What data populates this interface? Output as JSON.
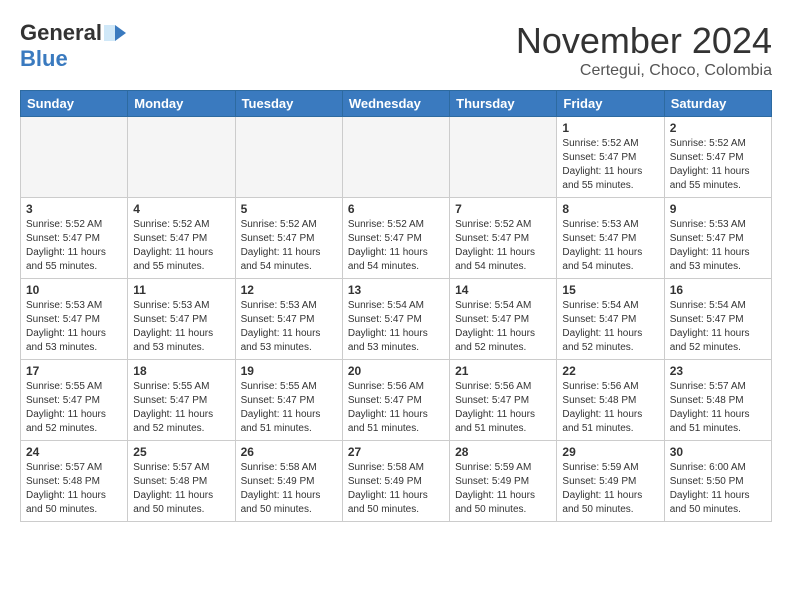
{
  "logo": {
    "general": "General",
    "blue": "Blue"
  },
  "title": "November 2024",
  "location": "Certegui, Choco, Colombia",
  "headers": [
    "Sunday",
    "Monday",
    "Tuesday",
    "Wednesday",
    "Thursday",
    "Friday",
    "Saturday"
  ],
  "weeks": [
    [
      {
        "day": "",
        "empty": true
      },
      {
        "day": "",
        "empty": true
      },
      {
        "day": "",
        "empty": true
      },
      {
        "day": "",
        "empty": true
      },
      {
        "day": "",
        "empty": true
      },
      {
        "day": "1",
        "sunrise": "Sunrise: 5:52 AM",
        "sunset": "Sunset: 5:47 PM",
        "daylight": "Daylight: 11 hours and 55 minutes."
      },
      {
        "day": "2",
        "sunrise": "Sunrise: 5:52 AM",
        "sunset": "Sunset: 5:47 PM",
        "daylight": "Daylight: 11 hours and 55 minutes."
      }
    ],
    [
      {
        "day": "3",
        "sunrise": "Sunrise: 5:52 AM",
        "sunset": "Sunset: 5:47 PM",
        "daylight": "Daylight: 11 hours and 55 minutes."
      },
      {
        "day": "4",
        "sunrise": "Sunrise: 5:52 AM",
        "sunset": "Sunset: 5:47 PM",
        "daylight": "Daylight: 11 hours and 55 minutes."
      },
      {
        "day": "5",
        "sunrise": "Sunrise: 5:52 AM",
        "sunset": "Sunset: 5:47 PM",
        "daylight": "Daylight: 11 hours and 54 minutes."
      },
      {
        "day": "6",
        "sunrise": "Sunrise: 5:52 AM",
        "sunset": "Sunset: 5:47 PM",
        "daylight": "Daylight: 11 hours and 54 minutes."
      },
      {
        "day": "7",
        "sunrise": "Sunrise: 5:52 AM",
        "sunset": "Sunset: 5:47 PM",
        "daylight": "Daylight: 11 hours and 54 minutes."
      },
      {
        "day": "8",
        "sunrise": "Sunrise: 5:53 AM",
        "sunset": "Sunset: 5:47 PM",
        "daylight": "Daylight: 11 hours and 54 minutes."
      },
      {
        "day": "9",
        "sunrise": "Sunrise: 5:53 AM",
        "sunset": "Sunset: 5:47 PM",
        "daylight": "Daylight: 11 hours and 53 minutes."
      }
    ],
    [
      {
        "day": "10",
        "sunrise": "Sunrise: 5:53 AM",
        "sunset": "Sunset: 5:47 PM",
        "daylight": "Daylight: 11 hours and 53 minutes."
      },
      {
        "day": "11",
        "sunrise": "Sunrise: 5:53 AM",
        "sunset": "Sunset: 5:47 PM",
        "daylight": "Daylight: 11 hours and 53 minutes."
      },
      {
        "day": "12",
        "sunrise": "Sunrise: 5:53 AM",
        "sunset": "Sunset: 5:47 PM",
        "daylight": "Daylight: 11 hours and 53 minutes."
      },
      {
        "day": "13",
        "sunrise": "Sunrise: 5:54 AM",
        "sunset": "Sunset: 5:47 PM",
        "daylight": "Daylight: 11 hours and 53 minutes."
      },
      {
        "day": "14",
        "sunrise": "Sunrise: 5:54 AM",
        "sunset": "Sunset: 5:47 PM",
        "daylight": "Daylight: 11 hours and 52 minutes."
      },
      {
        "day": "15",
        "sunrise": "Sunrise: 5:54 AM",
        "sunset": "Sunset: 5:47 PM",
        "daylight": "Daylight: 11 hours and 52 minutes."
      },
      {
        "day": "16",
        "sunrise": "Sunrise: 5:54 AM",
        "sunset": "Sunset: 5:47 PM",
        "daylight": "Daylight: 11 hours and 52 minutes."
      }
    ],
    [
      {
        "day": "17",
        "sunrise": "Sunrise: 5:55 AM",
        "sunset": "Sunset: 5:47 PM",
        "daylight": "Daylight: 11 hours and 52 minutes."
      },
      {
        "day": "18",
        "sunrise": "Sunrise: 5:55 AM",
        "sunset": "Sunset: 5:47 PM",
        "daylight": "Daylight: 11 hours and 52 minutes."
      },
      {
        "day": "19",
        "sunrise": "Sunrise: 5:55 AM",
        "sunset": "Sunset: 5:47 PM",
        "daylight": "Daylight: 11 hours and 51 minutes."
      },
      {
        "day": "20",
        "sunrise": "Sunrise: 5:56 AM",
        "sunset": "Sunset: 5:47 PM",
        "daylight": "Daylight: 11 hours and 51 minutes."
      },
      {
        "day": "21",
        "sunrise": "Sunrise: 5:56 AM",
        "sunset": "Sunset: 5:47 PM",
        "daylight": "Daylight: 11 hours and 51 minutes."
      },
      {
        "day": "22",
        "sunrise": "Sunrise: 5:56 AM",
        "sunset": "Sunset: 5:48 PM",
        "daylight": "Daylight: 11 hours and 51 minutes."
      },
      {
        "day": "23",
        "sunrise": "Sunrise: 5:57 AM",
        "sunset": "Sunset: 5:48 PM",
        "daylight": "Daylight: 11 hours and 51 minutes."
      }
    ],
    [
      {
        "day": "24",
        "sunrise": "Sunrise: 5:57 AM",
        "sunset": "Sunset: 5:48 PM",
        "daylight": "Daylight: 11 hours and 50 minutes."
      },
      {
        "day": "25",
        "sunrise": "Sunrise: 5:57 AM",
        "sunset": "Sunset: 5:48 PM",
        "daylight": "Daylight: 11 hours and 50 minutes."
      },
      {
        "day": "26",
        "sunrise": "Sunrise: 5:58 AM",
        "sunset": "Sunset: 5:49 PM",
        "daylight": "Daylight: 11 hours and 50 minutes."
      },
      {
        "day": "27",
        "sunrise": "Sunrise: 5:58 AM",
        "sunset": "Sunset: 5:49 PM",
        "daylight": "Daylight: 11 hours and 50 minutes."
      },
      {
        "day": "28",
        "sunrise": "Sunrise: 5:59 AM",
        "sunset": "Sunset: 5:49 PM",
        "daylight": "Daylight: 11 hours and 50 minutes."
      },
      {
        "day": "29",
        "sunrise": "Sunrise: 5:59 AM",
        "sunset": "Sunset: 5:49 PM",
        "daylight": "Daylight: 11 hours and 50 minutes."
      },
      {
        "day": "30",
        "sunrise": "Sunrise: 6:00 AM",
        "sunset": "Sunset: 5:50 PM",
        "daylight": "Daylight: 11 hours and 50 minutes."
      }
    ]
  ]
}
